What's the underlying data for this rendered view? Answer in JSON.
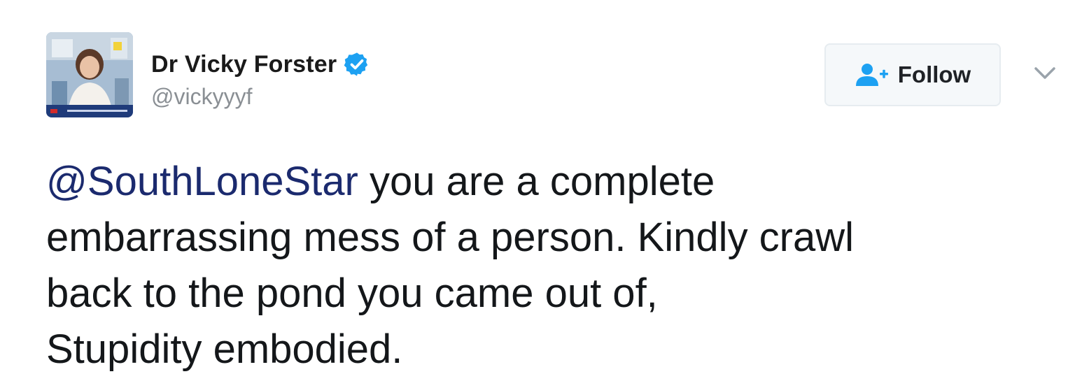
{
  "user": {
    "display_name": "Dr Vicky Forster",
    "handle": "@vickyyyf",
    "verified": true,
    "verified_icon": "verified-badge-icon",
    "avatar_icon": "profile-photo"
  },
  "follow_button": {
    "label": "Follow",
    "icon": "follow-user-icon"
  },
  "menu_caret": {
    "icon": "chevron-down-icon"
  },
  "tweet": {
    "mention": "@SouthLoneStar",
    "line1_rest": " you are a complete",
    "line2": "embarrassing mess of a person. Kindly crawl",
    "line3": "back to the pond you came out of,",
    "line4": "Stupidity embodied."
  },
  "colors": {
    "verified": "#1da1f2",
    "follow_icon": "#1da1f2",
    "mention": "#1b2a6e",
    "handle": "#8a8f94",
    "text": "#14171a"
  }
}
